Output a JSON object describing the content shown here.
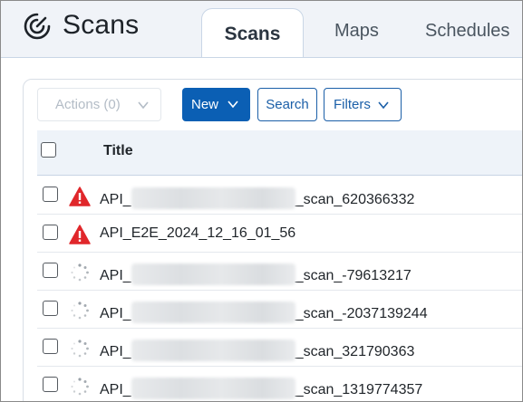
{
  "app": {
    "title": "Scans"
  },
  "tabs": [
    {
      "label": "Scans",
      "active": true
    },
    {
      "label": "Maps",
      "active": false
    },
    {
      "label": "Schedules",
      "active": false
    }
  ],
  "toolbar": {
    "actions_label": "Actions (0)",
    "new_label": "New",
    "search_label": "Search",
    "filters_label": "Filters"
  },
  "table": {
    "column_title": "Title",
    "rows": [
      {
        "prefix": "API_",
        "suffix": "_scan_620366332",
        "status_icon": "warning-icon",
        "redacted": true
      },
      {
        "prefix": "API_E2E_2024_12_16_01_56",
        "suffix": "",
        "status_icon": "warning-icon",
        "redacted": false
      },
      {
        "prefix": "API_",
        "suffix": "_scan_-79613217",
        "status_icon": "loading-spinner-icon",
        "redacted": true
      },
      {
        "prefix": "API_",
        "suffix": "_scan_-2037139244",
        "status_icon": "loading-spinner-icon",
        "redacted": true
      },
      {
        "prefix": "API_",
        "suffix": "_scan_321790363",
        "status_icon": "loading-spinner-icon",
        "redacted": true
      },
      {
        "prefix": "API_",
        "suffix": "_scan_1319774357",
        "status_icon": "loading-spinner-icon",
        "redacted": true
      }
    ]
  },
  "colors": {
    "primary": "#0b5fb4",
    "warning": "#e0272b",
    "header_bg": "#f0f3f8",
    "table_header_bg": "#eef3f9"
  }
}
